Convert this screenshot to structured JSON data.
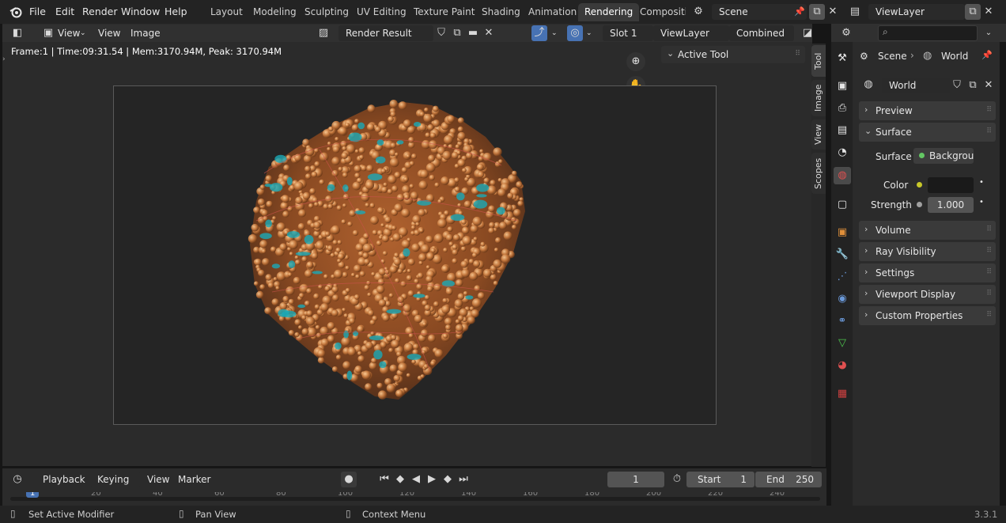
{
  "topbar": {
    "menus": [
      "File",
      "Edit",
      "Render",
      "Window",
      "Help"
    ],
    "workspaces": [
      "Layout",
      "Modeling",
      "Sculpting",
      "UV Editing",
      "Texture Paint",
      "Shading",
      "Animation",
      "Rendering",
      "Compositi"
    ],
    "active_workspace": "Rendering",
    "scene": "Scene",
    "view_layer": "ViewLayer"
  },
  "image_editor": {
    "header": {
      "view_menu": "View",
      "menus": [
        "View",
        "Image"
      ],
      "image_name": "Render Result",
      "slot": "Slot 1",
      "view_layer": "ViewLayer",
      "pass": "Combined"
    },
    "render_info": "Frame:1 | Time:09:31.54 | Mem:3170.94M, Peak: 3170.94M",
    "active_tool_label": "Active Tool",
    "side_tabs": [
      "Tool",
      "Image",
      "View",
      "Scopes"
    ]
  },
  "timeline": {
    "menus": [
      "Playback",
      "Keying",
      "View",
      "Marker"
    ],
    "current_frame": "1",
    "start_label": "Start",
    "start": "1",
    "end_label": "End",
    "end": "250",
    "ruler": [
      "1",
      "20",
      "40",
      "60",
      "80",
      "100",
      "120",
      "140",
      "160",
      "180",
      "200",
      "220",
      "240"
    ]
  },
  "properties": {
    "breadcrumb": {
      "scene": "Scene",
      "world": "World"
    },
    "world_name": "World",
    "panels": {
      "preview": "Preview",
      "surface": "Surface",
      "volume": "Volume",
      "ray_visibility": "Ray Visibility",
      "settings": "Settings",
      "viewport_display": "Viewport Display",
      "custom_properties": "Custom Properties"
    },
    "surface": {
      "surface_label": "Surface",
      "surface_value": "Backgroun",
      "color_label": "Color",
      "strength_label": "Strength",
      "strength_value": "1.000"
    }
  },
  "statusbar": {
    "left": "Set Active Modifier",
    "mid": "Pan View",
    "right": "Context Menu",
    "version": "3.3.1"
  },
  "colors": {
    "accent_blue": "#4772b3",
    "surface_socket": "#63c763",
    "color_socket": "#c7c729",
    "render_orange": "#c87a3e",
    "render_cyan": "#1aa9b6"
  }
}
